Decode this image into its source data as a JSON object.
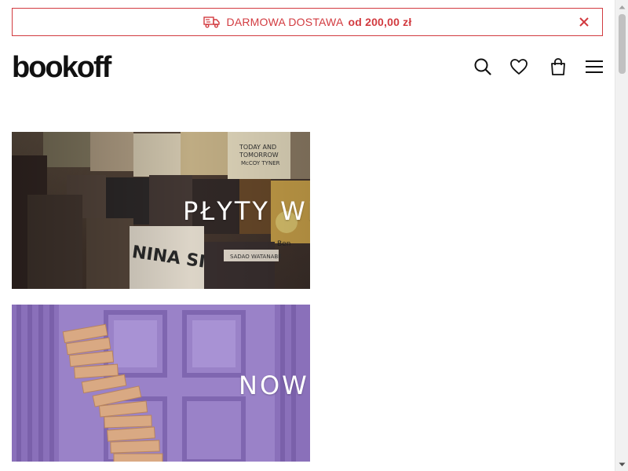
{
  "promo": {
    "text": "DARMOWA DOSTAWA",
    "amount": "od 200,00 zł",
    "icon": "delivery-truck-icon",
    "close_icon": "close-icon",
    "color": "#d23b40"
  },
  "header": {
    "logo": "bookoff",
    "icons": [
      "search-icon",
      "heart-icon",
      "shopping-bag-icon",
      "hamburger-menu-icon"
    ]
  },
  "banners": [
    {
      "caption": "PŁYTY WI",
      "image": "vinyl-records-store-photo"
    },
    {
      "caption": "NOW",
      "image": "purple-door-boxes-photo"
    }
  ],
  "colors": {
    "accent": "#d23b40",
    "text": "#111111",
    "scrollbar_thumb": "#c1c1c1"
  }
}
